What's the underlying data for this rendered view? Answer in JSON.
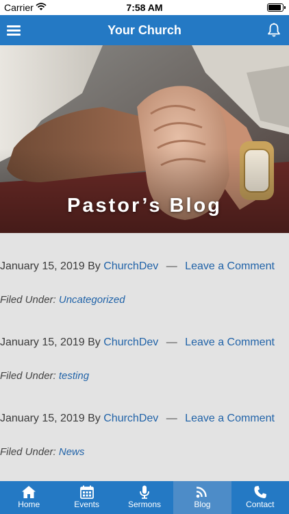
{
  "status_bar": {
    "carrier": "Carrier",
    "time": "7:58 AM",
    "battery_level": 0.92
  },
  "header": {
    "title": "Your Church"
  },
  "hero": {
    "title": "Pastor’s Blog"
  },
  "posts": [
    {
      "date": "January 15, 2019",
      "by": "By",
      "author": "ChurchDev",
      "dash": "—",
      "comment": "Leave a Comment",
      "filed_label": "Filed Under:",
      "category": "Uncategorized"
    },
    {
      "date": "January 15, 2019",
      "by": "By",
      "author": "ChurchDev",
      "dash": "—",
      "comment": "Leave a Comment",
      "filed_label": "Filed Under:",
      "category": "testing"
    },
    {
      "date": "January 15, 2019",
      "by": "By",
      "author": "ChurchDev",
      "dash": "—",
      "comment": "Leave a Comment",
      "filed_label": "Filed Under:",
      "category": "News"
    }
  ],
  "tabs": [
    {
      "label": "Home",
      "icon": "home-icon"
    },
    {
      "label": "Events",
      "icon": "calendar-icon"
    },
    {
      "label": "Sermons",
      "icon": "microphone-icon"
    },
    {
      "label": "Blog",
      "icon": "rss-icon",
      "active": true
    },
    {
      "label": "Contact",
      "icon": "phone-icon"
    }
  ],
  "colors": {
    "brand": "#2479c4",
    "active_tab": "#4d8cc8",
    "link": "#2163a8",
    "background": "#e3e3e3"
  }
}
